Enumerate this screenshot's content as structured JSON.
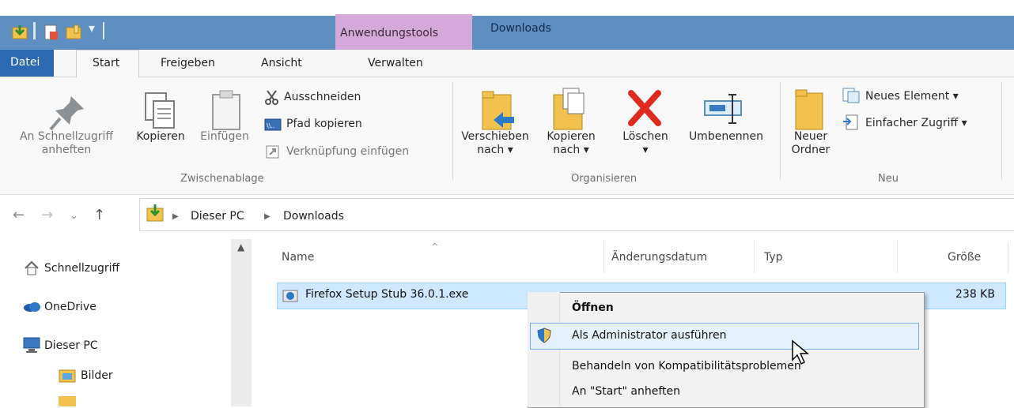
{
  "window": {
    "contextual_tab": "Anwendungstools",
    "title": "Downloads"
  },
  "tabs": {
    "datei": "Datei",
    "start": "Start",
    "freigeben": "Freigeben",
    "ansicht": "Ansicht",
    "verwalten": "Verwalten"
  },
  "ribbon": {
    "clipboard": {
      "pin_line1": "An Schnellzugriff",
      "pin_line2": "anheften",
      "copy": "Kopieren",
      "paste": "Einfügen",
      "cut": "Ausschneiden",
      "copy_path": "Pfad kopieren",
      "paste_shortcut": "Verknüpfung einfügen",
      "group": "Zwischenablage"
    },
    "organize": {
      "move_line1": "Verschieben",
      "move_line2": "nach ▾",
      "copyto_line1": "Kopieren",
      "copyto_line2": "nach ▾",
      "delete": "Löschen",
      "delete_arrow": "▾",
      "rename": "Umbenennen",
      "group": "Organisieren"
    },
    "new": {
      "folder_line1": "Neuer",
      "folder_line2": "Ordner",
      "new_item": "Neues Element ▾",
      "easy_access": "Einfacher Zugriff ▾",
      "group": "Neu"
    }
  },
  "address": {
    "this_pc": "Dieser PC",
    "downloads": "Downloads"
  },
  "sidebar": {
    "items": [
      {
        "label": "Schnellzugriff"
      },
      {
        "label": "OneDrive"
      },
      {
        "label": "Dieser PC"
      },
      {
        "label": "Bilder"
      }
    ]
  },
  "columns": {
    "name": "Name",
    "date": "Änderungsdatum",
    "type": "Typ",
    "size": "Größe"
  },
  "file": {
    "name": "Firefox Setup Stub 36.0.1.exe",
    "size": "238 KB"
  },
  "context_menu": {
    "items": [
      {
        "label": "Öffnen"
      },
      {
        "label": "Als Administrator ausführen"
      },
      {
        "label": "Behandeln von Kompatibilitätsproblemen"
      },
      {
        "label": "An \"Start\" anheften"
      }
    ]
  },
  "colors": {
    "titlebar": "#5f8fc0",
    "contextual": "#d4a8d8",
    "datei": "#2b6ab3",
    "selection": "#cde8ff"
  }
}
